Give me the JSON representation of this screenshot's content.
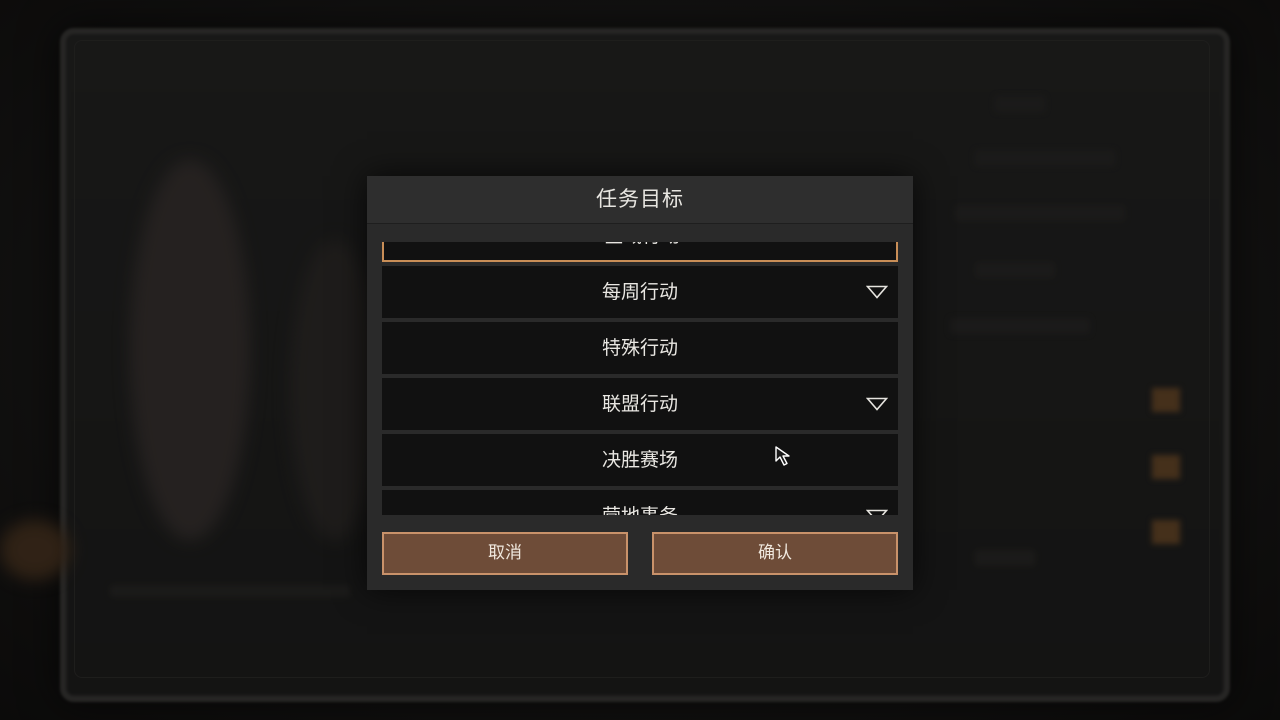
{
  "dialog": {
    "title": "任务目标",
    "items": [
      {
        "label": "区域行动",
        "expandable": true,
        "selected": true
      },
      {
        "label": "每周行动",
        "expandable": true,
        "selected": false
      },
      {
        "label": "特殊行动",
        "expandable": false,
        "selected": false
      },
      {
        "label": "联盟行动",
        "expandable": true,
        "selected": false
      },
      {
        "label": "决胜赛场",
        "expandable": false,
        "selected": false
      },
      {
        "label": "营地事务",
        "expandable": true,
        "selected": false
      }
    ],
    "buttons": {
      "cancel": "取消",
      "confirm": "确认"
    }
  },
  "colors": {
    "accent": "#c98e57",
    "button_fill": "#6e4c38",
    "button_border": "#c9926a",
    "item_bg": "#111111",
    "dialog_bg": "#2a2a2a"
  },
  "icons": {
    "expand": "chevron-down-icon",
    "pointer": "mouse-cursor-icon"
  }
}
